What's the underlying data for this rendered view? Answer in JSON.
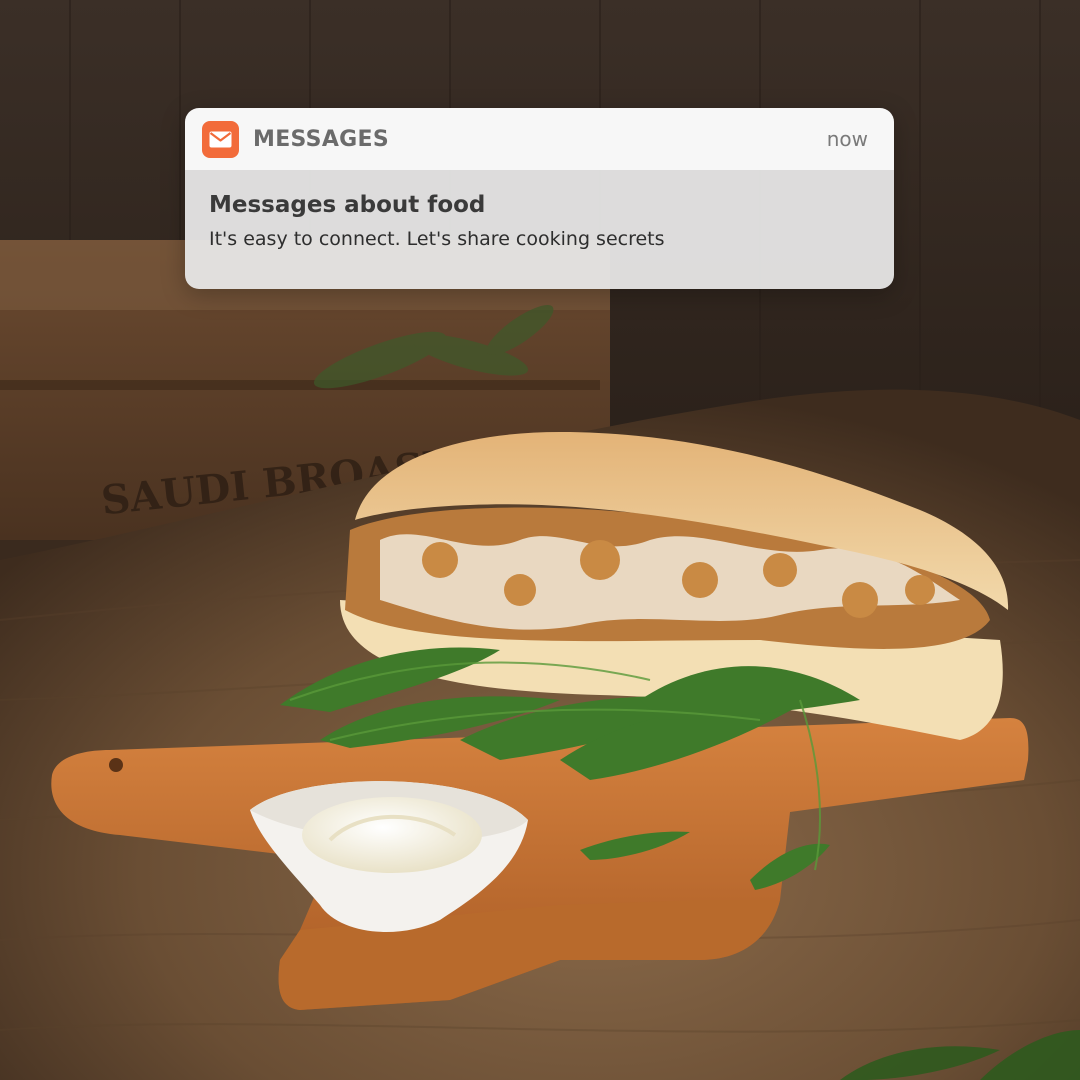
{
  "notification": {
    "app_icon": "envelope-icon",
    "app_name": "MESSAGES",
    "time": "now",
    "title": "Messages about food",
    "body": "It's easy to connect. Let's share cooking secrets"
  },
  "background": {
    "crate_stamp": "SAUDI BROASTED"
  },
  "colors": {
    "accent": "#f26b3a",
    "header_bg": "#f7f7f7",
    "body_bg": "#e8e8e8"
  }
}
